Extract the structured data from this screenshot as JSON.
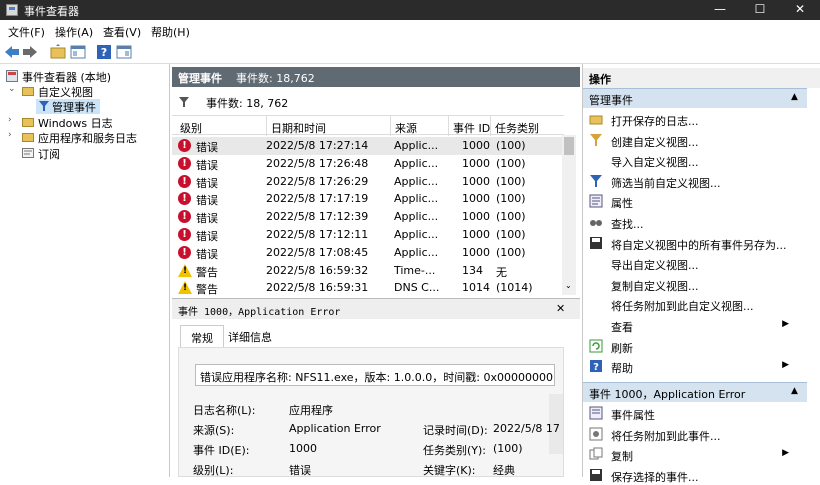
{
  "window": {
    "title": "事件查看器",
    "minimize": "—",
    "maximize": "☐",
    "close": "✕"
  },
  "menu": [
    "文件(F)",
    "操作(A)",
    "查看(V)",
    "帮助(H)"
  ],
  "tree": {
    "root": "事件查看器 (本地)",
    "custom_views": "自定义视图",
    "admin_events": "管理事件",
    "windows_logs": "Windows 日志",
    "app_service_logs": "应用程序和服务日志",
    "subscriptions": "订阅"
  },
  "center_header": {
    "title": "管理事件",
    "count": "事件数: 18,762"
  },
  "filter_bar": {
    "text": "事件数:  18, 762"
  },
  "grid": {
    "columns": [
      "级别",
      "日期和时间",
      "来源",
      "事件 ID",
      "任务类别"
    ],
    "rows": [
      {
        "level": "错误",
        "type": "error",
        "datetime": "2022/5/8 17:27:14",
        "source": "Applic...",
        "id": "1000",
        "task": "(100)"
      },
      {
        "level": "错误",
        "type": "error",
        "datetime": "2022/5/8 17:26:48",
        "source": "Applic...",
        "id": "1000",
        "task": "(100)"
      },
      {
        "level": "错误",
        "type": "error",
        "datetime": "2022/5/8 17:26:29",
        "source": "Applic...",
        "id": "1000",
        "task": "(100)"
      },
      {
        "level": "错误",
        "type": "error",
        "datetime": "2022/5/8 17:17:19",
        "source": "Applic...",
        "id": "1000",
        "task": "(100)"
      },
      {
        "level": "错误",
        "type": "error",
        "datetime": "2022/5/8 17:12:39",
        "source": "Applic...",
        "id": "1000",
        "task": "(100)"
      },
      {
        "level": "错误",
        "type": "error",
        "datetime": "2022/5/8 17:12:11",
        "source": "Applic...",
        "id": "1000",
        "task": "(100)"
      },
      {
        "level": "错误",
        "type": "error",
        "datetime": "2022/5/8 17:08:45",
        "source": "Applic...",
        "id": "1000",
        "task": "(100)"
      },
      {
        "level": "警告",
        "type": "warning",
        "datetime": "2022/5/8 16:59:32",
        "source": "Time-...",
        "id": "134",
        "task": "无"
      },
      {
        "level": "警告",
        "type": "warning",
        "datetime": "2022/5/8 16:59:31",
        "source": "DNS C...",
        "id": "1014",
        "task": "(1014)"
      }
    ]
  },
  "detail": {
    "title": "事件 1000，Application Error",
    "close": "✕",
    "tabs": [
      "常规",
      "详细信息"
    ],
    "message": "错误应用程序名称: NFS11.exe，版本: 1.0.0.0，时间戳: 0x00000000",
    "fields": {
      "log_name_label": "日志名称(L):",
      "log_name": "应用程序",
      "source_label": "来源(S):",
      "source": "Application Error",
      "event_id_label": "事件 ID(E):",
      "event_id": "1000",
      "level_label": "级别(L):",
      "level": "错误",
      "recorded_label": "记录时间(D):",
      "recorded": "2022/5/8 17",
      "task_label": "任务类别(Y):",
      "task": "(100)",
      "keywords_label": "关键字(K):",
      "keywords": "经典"
    }
  },
  "actions": {
    "header": "操作",
    "section1": "管理事件",
    "items1": [
      "打开保存的日志...",
      "创建自定义视图...",
      "导入自定义视图...",
      "筛选当前自定义视图...",
      "属性",
      "查找...",
      "将自定义视图中的所有事件另存为...",
      "导出自定义视图...",
      "复制自定义视图...",
      "将任务附加到此自定义视图...",
      "查看",
      "刷新",
      "帮助"
    ],
    "section2": "事件 1000，Application Error",
    "items2": [
      "事件属性",
      "将任务附加到此事件...",
      "复制",
      "保存选择的事件..."
    ]
  }
}
